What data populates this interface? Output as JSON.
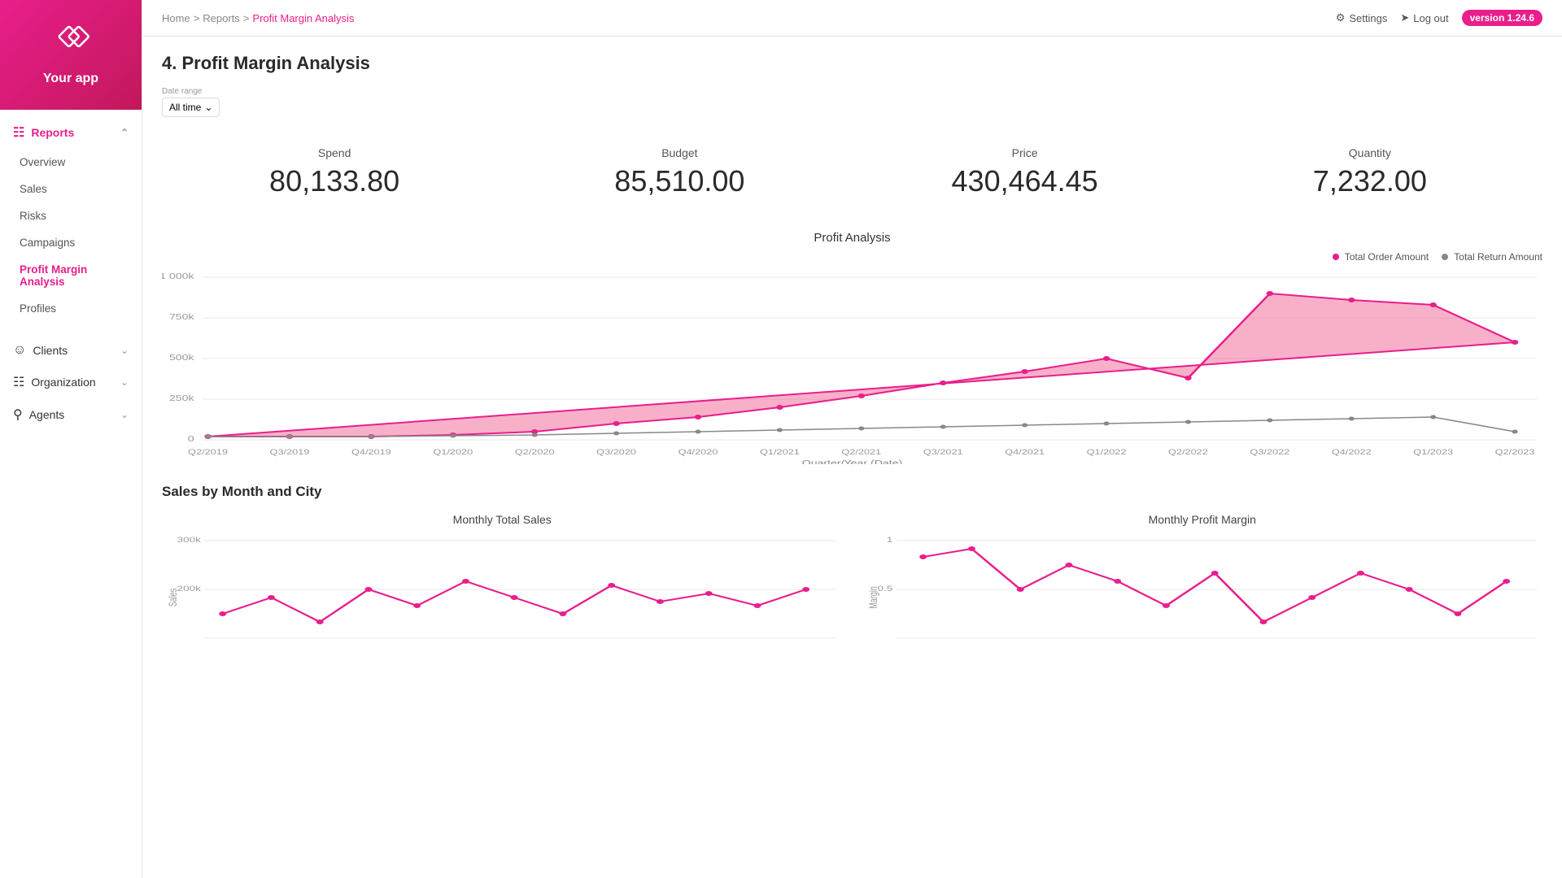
{
  "app": {
    "name": "Your app"
  },
  "version": "version 1.24.6",
  "topbar": {
    "settings_label": "Settings",
    "logout_label": "Log out"
  },
  "breadcrumb": {
    "home": "Home",
    "reports": "Reports",
    "current": "Profit Margin Analysis"
  },
  "page": {
    "title": "4. Profit Margin Analysis",
    "date_range_label": "Date range",
    "date_range_value": "All time"
  },
  "stats": [
    {
      "label": "Spend",
      "value": "80,133.80"
    },
    {
      "label": "Budget",
      "value": "85,510.00"
    },
    {
      "label": "Price",
      "value": "430,464.45"
    },
    {
      "label": "Quantity",
      "value": "7,232.00"
    }
  ],
  "profit_chart": {
    "title": "Profit Analysis",
    "legend": [
      {
        "label": "Total Order Amount",
        "color": "#e91e8c"
      },
      {
        "label": "Total Return Amount",
        "color": "#888"
      }
    ],
    "x_axis_label": "Quarter/Year (Date)",
    "x_labels": [
      "Q2/2019",
      "Q3/2019",
      "Q4/2019",
      "Q1/2020",
      "Q2/2020",
      "Q3/2020",
      "Q4/2020",
      "Q1/2021",
      "Q2/2021",
      "Q3/2021",
      "Q4/2021",
      "Q1/2022",
      "Q2/2022",
      "Q3/2022",
      "Q4/2022",
      "Q1/2023",
      "Q2/2023"
    ],
    "y_labels": [
      "0",
      "250k",
      "500k",
      "750k",
      "1 000k"
    ],
    "order_data": [
      2,
      2,
      2,
      3,
      5,
      10,
      14,
      20,
      27,
      35,
      42,
      50,
      38,
      90,
      85,
      83,
      60
    ],
    "return_data": [
      2,
      2,
      2,
      2,
      3,
      4,
      5,
      6,
      7,
      8,
      9,
      10,
      11,
      12,
      13,
      14,
      15
    ]
  },
  "bottom_section": {
    "title": "Sales by Month and City",
    "left_chart_title": "Monthly Total Sales",
    "right_chart_title": "Monthly Profit Margin",
    "left_y_label": "300k",
    "left_y_label2": "200k",
    "right_y_label": "1",
    "right_y_label2": "0.5"
  },
  "sidebar": {
    "reports_label": "Reports",
    "nav_items": [
      {
        "label": "Overview",
        "key": "overview"
      },
      {
        "label": "Sales",
        "key": "sales"
      },
      {
        "label": "Risks",
        "key": "risks"
      },
      {
        "label": "Campaigns",
        "key": "campaigns"
      },
      {
        "label": "Profit Margin Analysis",
        "key": "profit-margin",
        "active": true
      },
      {
        "label": "Profiles",
        "key": "profiles"
      }
    ],
    "section_items": [
      {
        "label": "Clients",
        "key": "clients"
      },
      {
        "label": "Organization",
        "key": "organization"
      },
      {
        "label": "Agents",
        "key": "agents"
      }
    ]
  }
}
